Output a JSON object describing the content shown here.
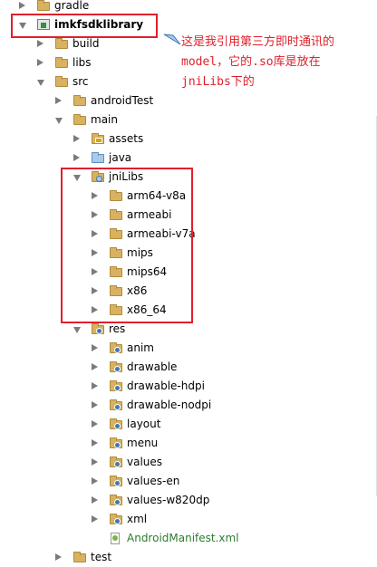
{
  "tree": {
    "rows": [
      {
        "label": "gradle",
        "indent": 0,
        "state": "collapsed",
        "icon": "folder",
        "partial": true
      },
      {
        "label": "imkfsdklibrary",
        "indent": 0,
        "state": "expanded",
        "icon": "library-module",
        "bold": true
      },
      {
        "label": "build",
        "indent": 1,
        "state": "collapsed",
        "icon": "folder"
      },
      {
        "label": "libs",
        "indent": 1,
        "state": "collapsed",
        "icon": "folder"
      },
      {
        "label": "src",
        "indent": 1,
        "state": "expanded",
        "icon": "folder"
      },
      {
        "label": "androidTest",
        "indent": 2,
        "state": "collapsed",
        "icon": "folder"
      },
      {
        "label": "main",
        "indent": 2,
        "state": "expanded",
        "icon": "folder"
      },
      {
        "label": "assets",
        "indent": 3,
        "state": "collapsed",
        "icon": "assets-folder"
      },
      {
        "label": "java",
        "indent": 3,
        "state": "collapsed",
        "icon": "source-folder"
      },
      {
        "label": "jniLibs",
        "indent": 3,
        "state": "expanded",
        "icon": "jni-folder"
      },
      {
        "label": "arm64-v8a",
        "indent": 4,
        "state": "collapsed",
        "icon": "folder"
      },
      {
        "label": "armeabi",
        "indent": 4,
        "state": "collapsed",
        "icon": "folder"
      },
      {
        "label": "armeabi-v7a",
        "indent": 4,
        "state": "collapsed",
        "icon": "folder"
      },
      {
        "label": "mips",
        "indent": 4,
        "state": "collapsed",
        "icon": "folder"
      },
      {
        "label": "mips64",
        "indent": 4,
        "state": "collapsed",
        "icon": "folder"
      },
      {
        "label": "x86",
        "indent": 4,
        "state": "collapsed",
        "icon": "folder"
      },
      {
        "label": "x86_64",
        "indent": 4,
        "state": "collapsed",
        "icon": "folder"
      },
      {
        "label": "res",
        "indent": 3,
        "state": "expanded",
        "icon": "res-folder"
      },
      {
        "label": "anim",
        "indent": 4,
        "state": "collapsed",
        "icon": "res-folder"
      },
      {
        "label": "drawable",
        "indent": 4,
        "state": "collapsed",
        "icon": "res-folder"
      },
      {
        "label": "drawable-hdpi",
        "indent": 4,
        "state": "collapsed",
        "icon": "res-folder"
      },
      {
        "label": "drawable-nodpi",
        "indent": 4,
        "state": "collapsed",
        "icon": "res-folder"
      },
      {
        "label": "layout",
        "indent": 4,
        "state": "collapsed",
        "icon": "res-folder"
      },
      {
        "label": "menu",
        "indent": 4,
        "state": "collapsed",
        "icon": "res-folder"
      },
      {
        "label": "values",
        "indent": 4,
        "state": "collapsed",
        "icon": "res-folder"
      },
      {
        "label": "values-en",
        "indent": 4,
        "state": "collapsed",
        "icon": "res-folder"
      },
      {
        "label": "values-w820dp",
        "indent": 4,
        "state": "collapsed",
        "icon": "res-folder"
      },
      {
        "label": "xml",
        "indent": 4,
        "state": "collapsed",
        "icon": "res-folder"
      },
      {
        "label": "AndroidManifest.xml",
        "indent": 4,
        "state": "none",
        "icon": "manifest-file",
        "green": true
      },
      {
        "label": "test",
        "indent": 2,
        "state": "collapsed",
        "icon": "folder"
      }
    ]
  },
  "annotation": {
    "text": "这是我引用第三方即时通讯的\nmodel，它的.so库是放在\njniLibs下的",
    "color": "#e0202b"
  },
  "colors": {
    "highlight": "#e0202b",
    "folder": "#d8b261",
    "source_folder": "#a9cbe8",
    "manifest_text": "#2c7d2c"
  }
}
